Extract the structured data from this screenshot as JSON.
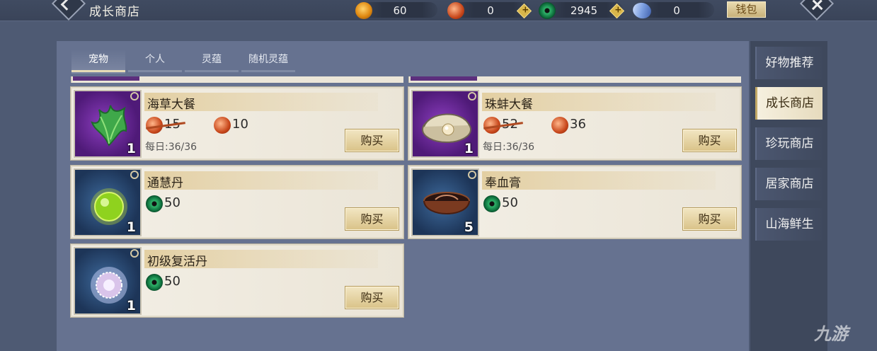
{
  "header": {
    "title": "成长商店",
    "wallet_label": "钱包",
    "currencies": [
      {
        "icon": "gold-coin-icon",
        "value": "60"
      },
      {
        "icon": "red-token-icon",
        "value": "0"
      },
      {
        "icon": "jade-coin-icon",
        "value": "2945"
      },
      {
        "icon": "blue-crystal-icon",
        "value": "0"
      }
    ],
    "plus_label": "+"
  },
  "tabs": [
    {
      "label": "宠物",
      "active": true
    },
    {
      "label": "个人",
      "active": false
    },
    {
      "label": "灵蕴",
      "active": false
    },
    {
      "label": "随机灵蕴",
      "active": false
    }
  ],
  "items": [
    {
      "name": "海草大餐",
      "qty": "1",
      "old_price": "15",
      "price": "10",
      "currency": "red-token",
      "daily": "每日:36/36",
      "buy": "购买"
    },
    {
      "name": "珠蚌大餐",
      "qty": "1",
      "old_price": "52",
      "price": "36",
      "currency": "red-token",
      "daily": "每日:36/36",
      "buy": "购买"
    },
    {
      "name": "通慧丹",
      "qty": "1",
      "price": "50",
      "currency": "jade-coin",
      "buy": "购买"
    },
    {
      "name": "奉血膏",
      "qty": "5",
      "price": "50",
      "currency": "jade-coin",
      "buy": "购买"
    },
    {
      "name": "初级复活丹",
      "qty": "1",
      "price": "50",
      "currency": "jade-coin",
      "buy": "购买"
    }
  ],
  "side_nav": [
    {
      "label": "好物推荐",
      "active": false
    },
    {
      "label": "成长商店",
      "active": true
    },
    {
      "label": "珍玩商店",
      "active": false
    },
    {
      "label": "居家商店",
      "active": false
    },
    {
      "label": "山海鲜生",
      "active": false
    }
  ],
  "watermark": "九游",
  "colors": {
    "accent_gold": "#d9c287",
    "panel": "#667290",
    "card": "#f3efe6"
  }
}
